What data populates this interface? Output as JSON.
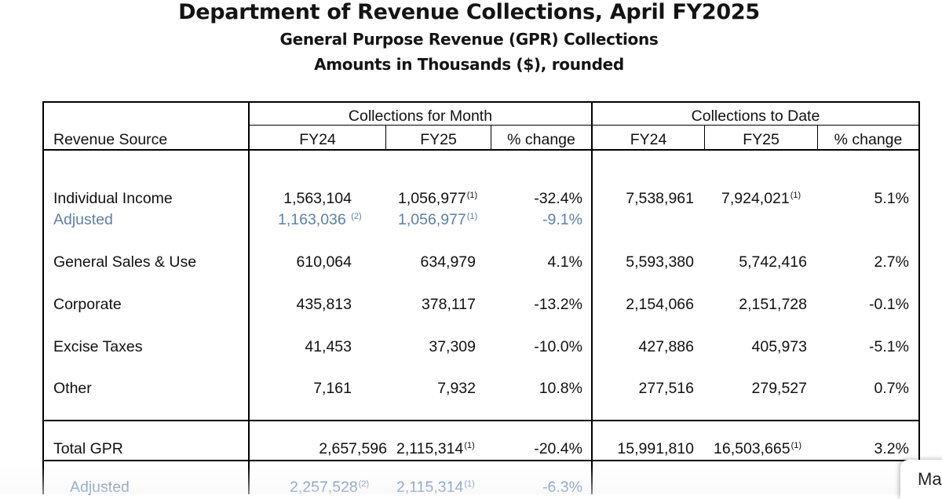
{
  "header": {
    "title": "Department of Revenue Collections, April FY2025",
    "subtitle": "General Purpose Revenue (GPR) Collections",
    "units": "Amounts in Thousands ($), rounded"
  },
  "table": {
    "group_month": "Collections for Month",
    "group_date": "Collections to Date",
    "col_source": "Revenue Source",
    "col_fy24": "FY24",
    "col_fy25": "FY25",
    "col_change": "% change",
    "rows": {
      "individual": {
        "label": "Individual Income",
        "m24": "1,563,104",
        "m25": "1,056,977",
        "m25_fn": "(1)",
        "mchg": "-32.4%",
        "d24": "7,538,961",
        "d25": "7,924,021",
        "d25_fn": "(1)",
        "dchg": "5.1%"
      },
      "individual_adj": {
        "label": "Adjusted",
        "m24": "1,163,036",
        "m24_fn": "(2)",
        "m25": "1,056,977",
        "m25_fn": "(1)",
        "mchg": "-9.1%"
      },
      "sales": {
        "label": "General Sales & Use",
        "m24": "610,064",
        "m25": "634,979",
        "mchg": "4.1%",
        "d24": "5,593,380",
        "d25": "5,742,416",
        "dchg": "2.7%"
      },
      "corporate": {
        "label": "Corporate",
        "m24": "435,813",
        "m25": "378,117",
        "mchg": "-13.2%",
        "d24": "2,154,066",
        "d25": "2,151,728",
        "dchg": "-0.1%"
      },
      "excise": {
        "label": "Excise Taxes",
        "m24": "41,453",
        "m25": "37,309",
        "mchg": "-10.0%",
        "d24": "427,886",
        "d25": "405,973",
        "dchg": "-5.1%"
      },
      "other": {
        "label": "Other",
        "m24": "7,161",
        "m25": "7,932",
        "mchg": "10.8%",
        "d24": "277,516",
        "d25": "279,527",
        "dchg": "0.7%"
      },
      "total": {
        "label": "Total GPR",
        "m24": "2,657,596",
        "m25": "2,115,314",
        "m25_fn": "(1)",
        "mchg": "-20.4%",
        "d24": "15,991,810",
        "d25": "16,503,665",
        "d25_fn": "(1)",
        "dchg": "3.2%"
      },
      "total_adj": {
        "label": "Adjusted",
        "m24": "2,257,528",
        "m24_fn": "(2)",
        "m25": "2,115,314",
        "m25_fn": "(1)",
        "mchg": "-6.3%"
      }
    }
  },
  "side_tab": {
    "label": "Ma"
  },
  "colors": {
    "adjusted": "#5c7fae",
    "text": "#111111",
    "rule": "#000000"
  }
}
